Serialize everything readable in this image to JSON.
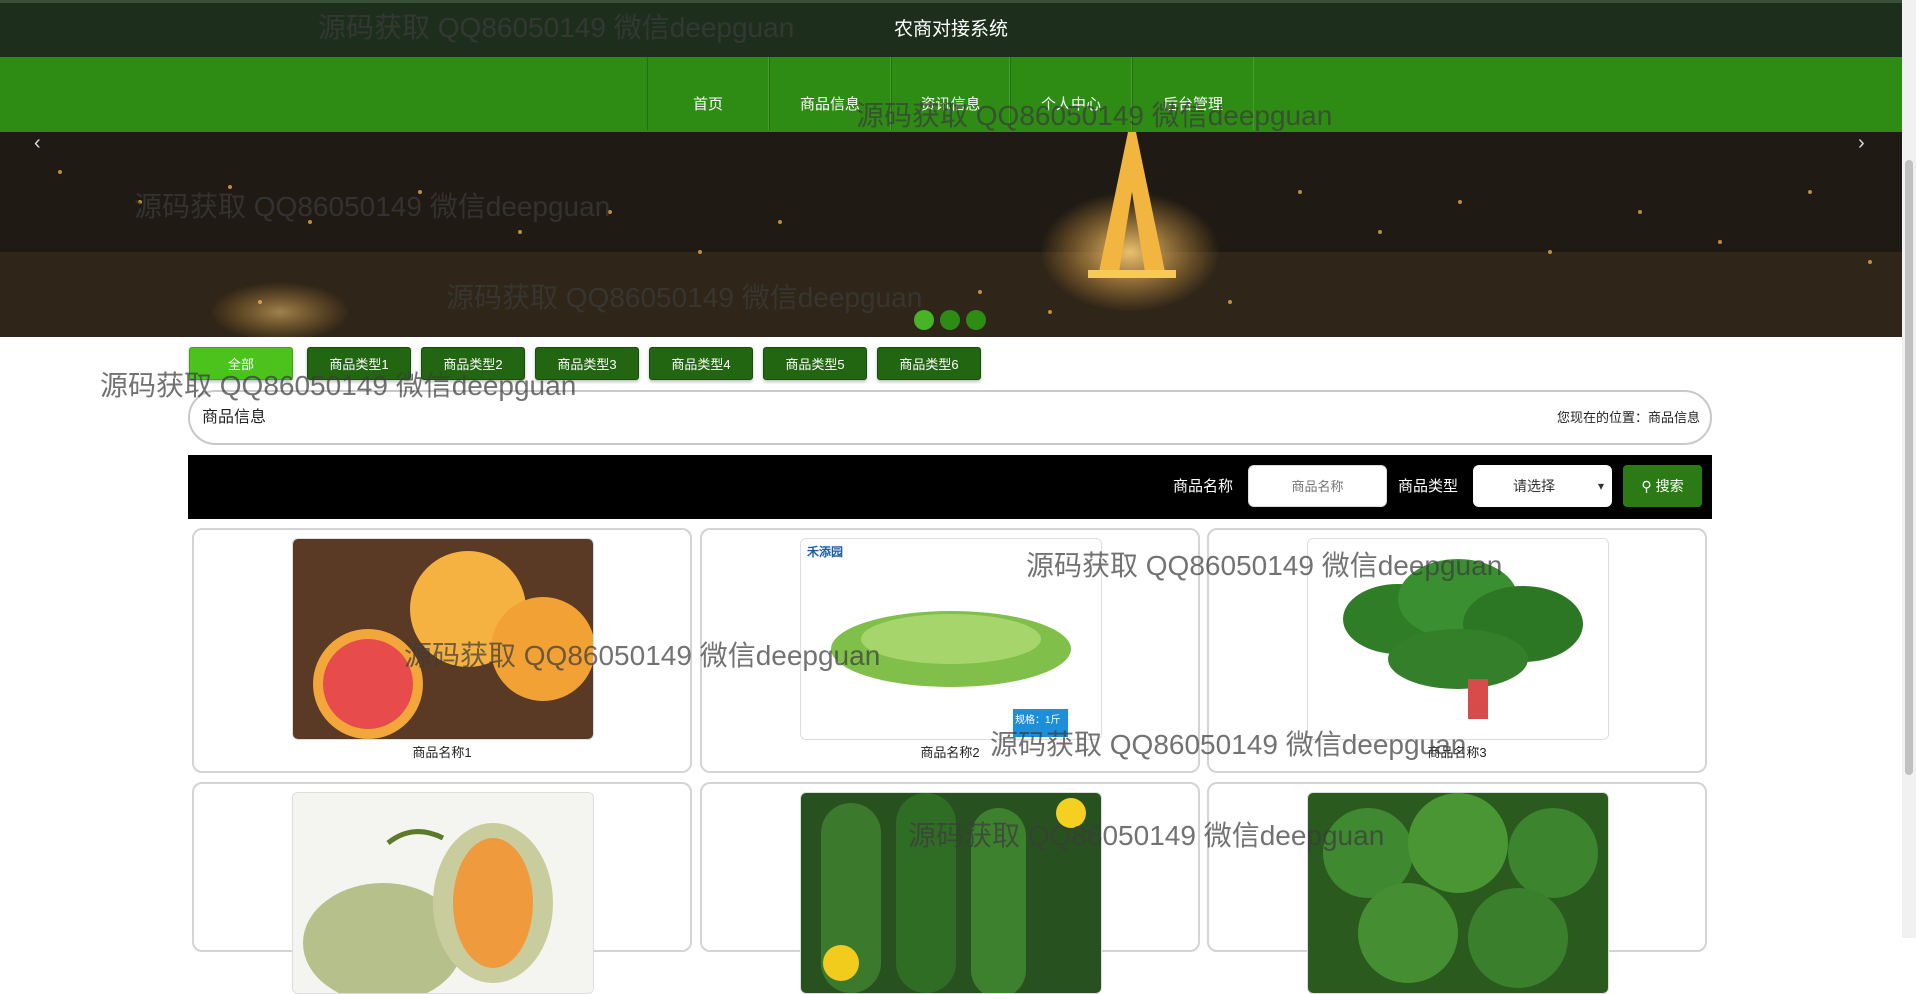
{
  "header": {
    "title": "农商对接系统"
  },
  "nav": [
    {
      "label": "首页"
    },
    {
      "label": "商品信息"
    },
    {
      "label": "资讯信息"
    },
    {
      "label": "个人中心"
    },
    {
      "label": "后台管理"
    }
  ],
  "banner": {
    "prev": "‹",
    "next": "›",
    "slides": 3,
    "active_slide": 1
  },
  "categories": [
    "全部",
    "商品类型1",
    "商品类型2",
    "商品类型3",
    "商品类型4",
    "商品类型5",
    "商品类型6"
  ],
  "breadcrumb": {
    "title": "商品信息",
    "location": "您现在的位置：商品信息"
  },
  "search": {
    "name_label": "商品名称",
    "name_placeholder": "商品名称",
    "type_label": "商品类型",
    "type_selected": "请选择",
    "button": "搜索"
  },
  "products": [
    {
      "name": "商品名称1",
      "image": "grapefruit"
    },
    {
      "name": "商品名称2",
      "image": "lettuce",
      "brand": "禾添园",
      "tag": "规格：1斤"
    },
    {
      "name": "商品名称3",
      "image": "spinach"
    },
    {
      "name": "",
      "image": "melon"
    },
    {
      "name": "",
      "image": "cucumber"
    },
    {
      "name": "",
      "image": "broccoli"
    }
  ],
  "watermark": "源码获取 QQ86050149 微信deepguan"
}
